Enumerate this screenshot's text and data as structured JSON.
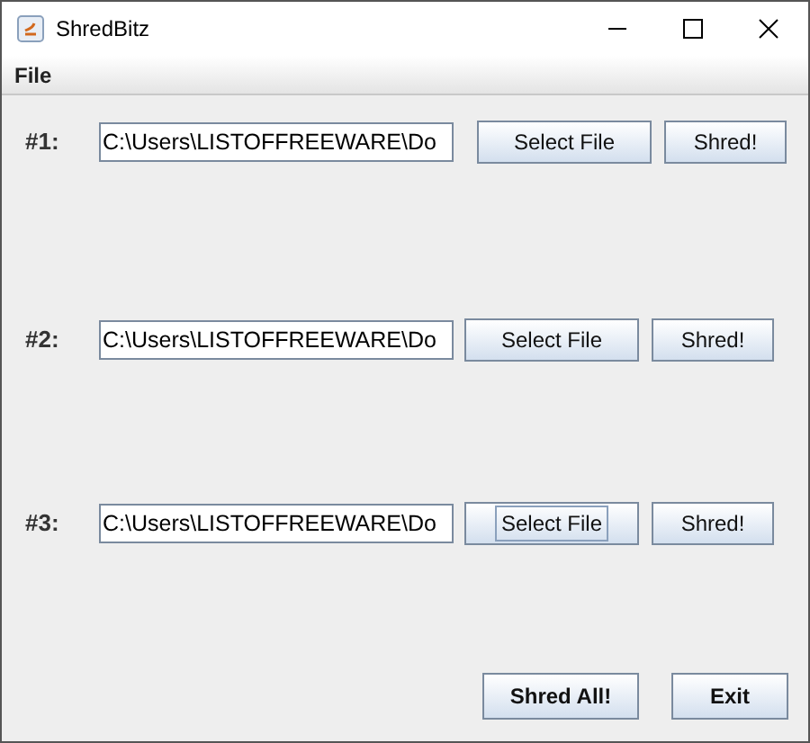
{
  "window": {
    "title": "ShredBitz"
  },
  "menu": [
    "File"
  ],
  "rows": [
    {
      "label": "#1:",
      "path": "C:\\Users\\LISTOFFREEWARE\\Do",
      "select_button": "Select File",
      "shred_button": "Shred!",
      "focused": false
    },
    {
      "label": "#2:",
      "path": "C:\\Users\\LISTOFFREEWARE\\Do",
      "select_button": "Select File",
      "shred_button": "Shred!",
      "focused": false
    },
    {
      "label": "#3:",
      "path": "C:\\Users\\LISTOFFREEWARE\\Do",
      "select_button": "Select File",
      "shred_button": "Shred!",
      "focused": true
    }
  ],
  "buttons": [
    "Shred All!",
    "Exit"
  ]
}
